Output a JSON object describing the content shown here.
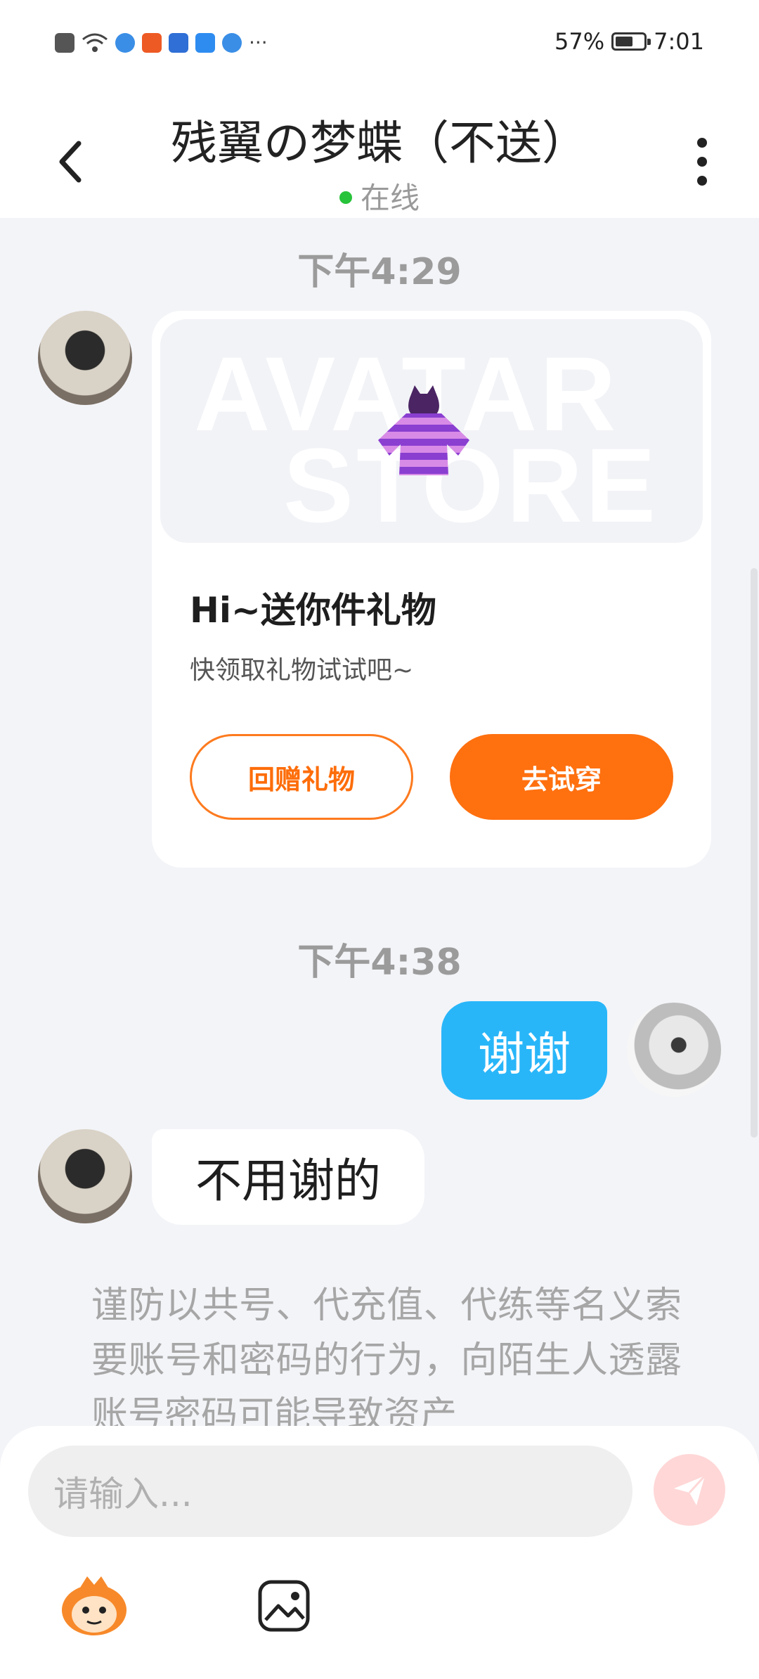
{
  "status_bar": {
    "battery": "57%",
    "time": "7:01",
    "more": "···"
  },
  "header": {
    "title": "残翼の梦蝶（不送）",
    "status": "在线"
  },
  "messages": {
    "time1": "下午4:29",
    "gift_card": {
      "watermark_line1": "AVATAR",
      "watermark_line2": "STORE",
      "title": "Hi~送你件礼物",
      "subtitle": "快领取礼物试试吧~",
      "return_button": "回赠礼物",
      "try_button": "去试穿"
    },
    "time2": "下午4:38",
    "my_message": "谢谢",
    "their_message": "不用谢的",
    "notice": "谨防以共号、代充值、代练等名义索要账号和密码的行为，向陌生人透露账号密码可能导致资产"
  },
  "input": {
    "placeholder": "请输入..."
  }
}
